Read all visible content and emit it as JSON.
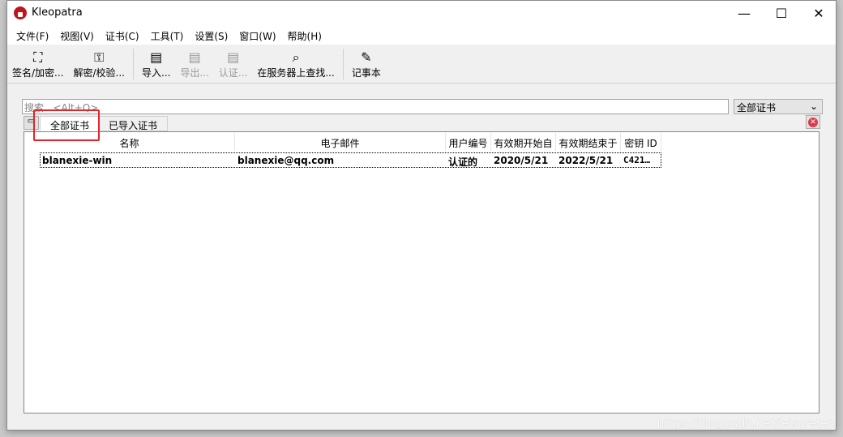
{
  "title": "Kleopatra",
  "menu": [
    "文件(F)",
    "视图(V)",
    "证书(C)",
    "工具(T)",
    "设置(S)",
    "窗口(W)",
    "帮助(H)"
  ],
  "toolbar": {
    "sign": "签名/加密...",
    "decrypt": "解密/校验...",
    "import": "导入...",
    "export": "导出...",
    "certify": "认证...",
    "lookup": "在服务器上查找...",
    "notepad": "记事本"
  },
  "search": {
    "placeholder": "搜索...<Alt+Q>"
  },
  "filter": {
    "selected": "全部证书"
  },
  "tabs": [
    "全部证书",
    "已导入证书"
  ],
  "columns": [
    "名称",
    "电子邮件",
    "用户编号",
    "有效期开始自",
    "有效期结束于",
    "密钥 ID"
  ],
  "rows": [
    [
      "blanexie-win",
      "blanexie@qq.com",
      "认证的",
      "2020/5/21",
      "2022/5/21",
      "C421…"
    ]
  ],
  "watermark": "https://blog.csdn.net/leisureten",
  "colors": {
    "highlight": "#e8222a",
    "brand": "#c0151b"
  }
}
